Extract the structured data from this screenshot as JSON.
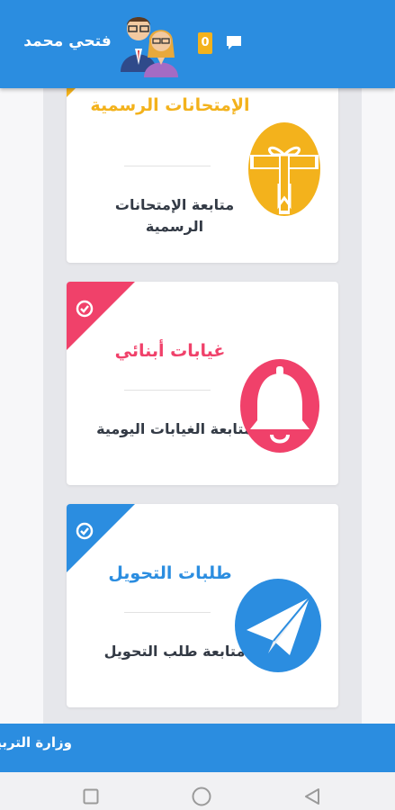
{
  "header": {
    "user_name": "فتحي محمد",
    "notification_count": "0",
    "colors": {
      "bar": "#2b8de0",
      "badge": "#f3b21c"
    }
  },
  "cards": [
    {
      "title": "الإمتحانات الرسمية",
      "subtitle": "متابعة الإمتحانات الرسمية",
      "icon": "gift-icon",
      "accent": "#f3b21c"
    },
    {
      "title": "غيابات أبنائي",
      "subtitle": "متابعة الغيابات اليومية",
      "icon": "bell-icon",
      "accent": "#f0416a"
    },
    {
      "title": "طلبات التحويل",
      "subtitle": "متابعة طلب التحويل",
      "icon": "paper-plane-icon",
      "accent": "#2b8de0"
    }
  ],
  "footer": {
    "text": "وزارة التربية"
  },
  "system_nav": {
    "buttons": [
      "recent-apps-icon",
      "home-icon",
      "back-icon"
    ]
  }
}
